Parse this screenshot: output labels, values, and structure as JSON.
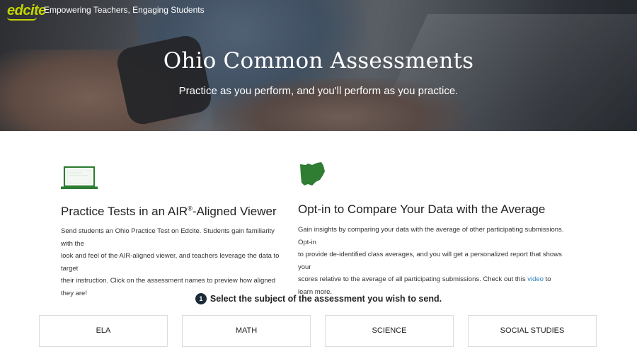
{
  "header": {
    "logo_text": "edcite",
    "tagline": "Empowering Teachers, Engaging Students",
    "brand_color": "#c4d600"
  },
  "hero": {
    "title": "Ohio Common Assessments",
    "subtitle": "Practice as you perform, and you'll perform as you practice."
  },
  "features": {
    "practice": {
      "icon": "laptop-icon",
      "title_prefix": "Practice Tests in an AIR",
      "title_sup": "®",
      "title_suffix": "-Aligned Viewer",
      "body_lines": [
        "Send students an Ohio Practice Test on Edcite. Students gain familiarity with the",
        "look and feel of the AIR-aligned viewer, and teachers leverage the data to target",
        "their instruction. Click on the assessment names to preview how aligned they are!"
      ]
    },
    "compare": {
      "icon": "ohio-state-icon",
      "title": "Opt-in to Compare Your Data with the Average",
      "body_lines": [
        "Gain insights by comparing your data with the average of other participating submissions. Opt-in",
        "to provide de-identified class averages, and you will get a personalized report that shows your"
      ],
      "body_last_prefix": "scores relative to the average of all participating submissions. Check out this ",
      "link_text": "video",
      "body_last_suffix": " to learn more.",
      "link_color": "#2a7fc1"
    },
    "icon_color": "#2e7d32"
  },
  "step": {
    "number": "1",
    "text": "Select the subject of the assessment you wish to send."
  },
  "subjects": [
    "ELA",
    "MATH",
    "SCIENCE",
    "SOCIAL STUDIES"
  ]
}
